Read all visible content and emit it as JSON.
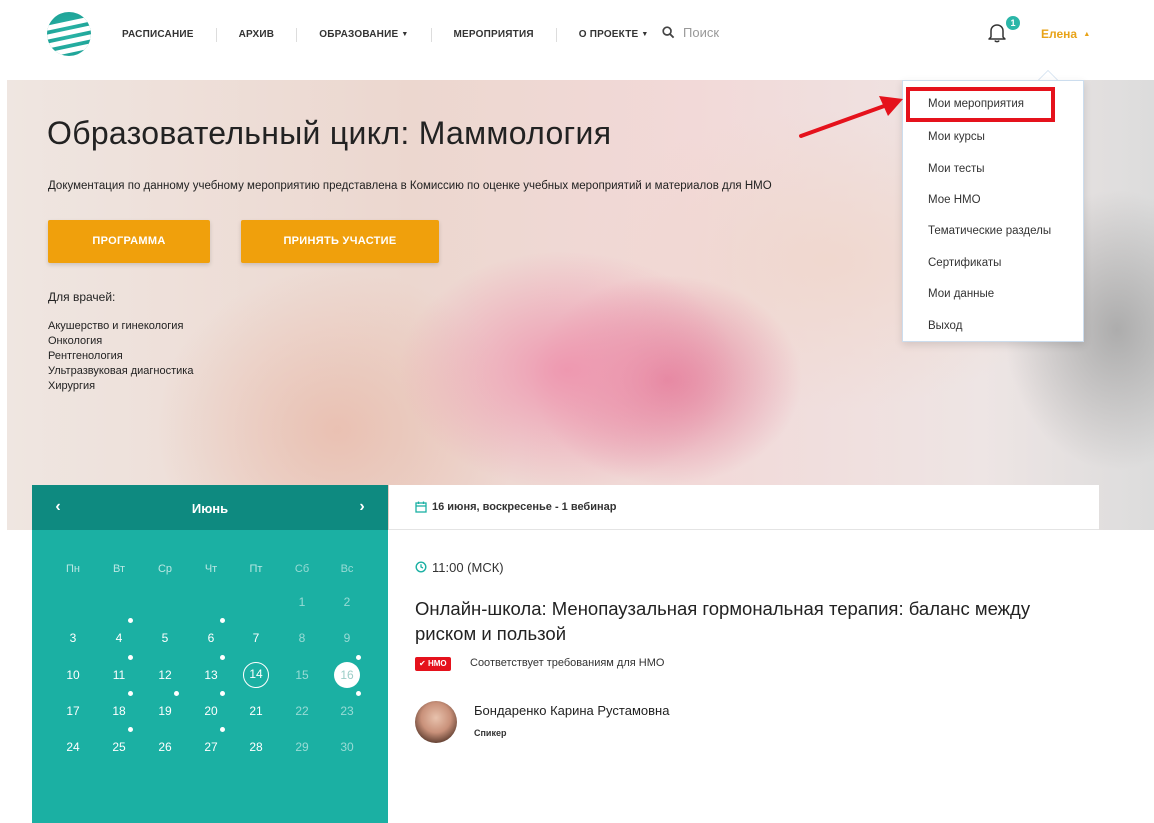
{
  "header": {
    "nav": [
      {
        "label": "РАСПИСАНИЕ",
        "has_caret": false
      },
      {
        "label": "АРХИВ",
        "has_caret": false
      },
      {
        "label": "ОБРАЗОВАНИЕ",
        "has_caret": true
      },
      {
        "label": "МЕРОПРИЯТИЯ",
        "has_caret": false
      },
      {
        "label": "О ПРОЕКТЕ",
        "has_caret": true
      }
    ],
    "search_placeholder": "Поиск",
    "notifications_count": "1",
    "user_name": "Елена"
  },
  "hero": {
    "title": "Образовательный цикл: Маммология",
    "description": "Документация по данному учебному мероприятию представлена в Комиссию по оценке учебных мероприятий и материалов для НМО",
    "button_program": "ПРОГРАММА",
    "button_join": "ПРИНЯТЬ УЧАСТИЕ",
    "doctors_label": "Для врачей:",
    "doctors": [
      "Акушерство и гинекология",
      "Онкология",
      "Рентгенология",
      "Ультразвуковая диагностика",
      "Хирургия"
    ]
  },
  "user_menu": {
    "items": [
      "Мои мероприятия",
      "Мои курсы",
      "Мои тесты",
      "Мое НМО",
      "Тематические разделы",
      "Сертификаты",
      "Мои данные",
      "Выход"
    ],
    "highlighted_index": 0
  },
  "calendar": {
    "month": "Июнь",
    "weekdays": [
      "Пн",
      "Вт",
      "Ср",
      "Чт",
      "Пт",
      "Сб",
      "Вс"
    ],
    "weeks": [
      [
        "",
        "",
        "",
        "",
        "",
        "1",
        "2"
      ],
      [
        "3",
        "4",
        "5",
        "6",
        "7",
        "8",
        "9"
      ],
      [
        "10",
        "11",
        "12",
        "13",
        "14",
        "15",
        "16"
      ],
      [
        "17",
        "18",
        "19",
        "20",
        "21",
        "22",
        "23"
      ],
      [
        "24",
        "25",
        "26",
        "27",
        "28",
        "29",
        "30"
      ]
    ],
    "today": "14",
    "selected": "16",
    "event_days": [
      "4",
      "6",
      "11",
      "13",
      "16",
      "18",
      "19",
      "20",
      "23",
      "25",
      "27"
    ]
  },
  "event": {
    "date_header": "16 июня, воскресенье - 1 вебинар",
    "time": "11:00 (МСК)",
    "title": "Онлайн-школа: Менопаузальная гормональная терапия: баланс между риском и пользой",
    "nmo_badge": "НМО",
    "nmo_text": "Соответствует требованиям для НМО",
    "speaker_name": "Бондаренко Карина Рустамовна",
    "speaker_role": "Спикер"
  },
  "colors": {
    "accent_orange": "#f0a00c",
    "teal": "#1bb0a3",
    "teal_dark": "#0e8a80",
    "highlight_red": "#e5121c"
  }
}
